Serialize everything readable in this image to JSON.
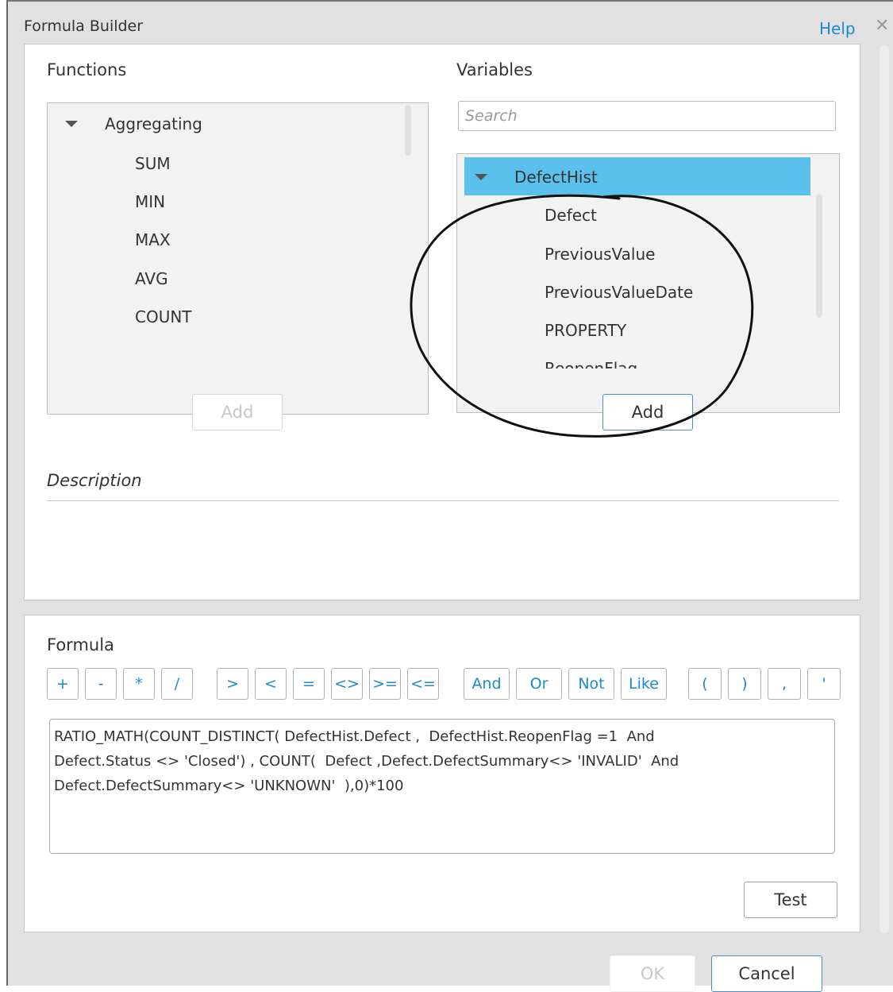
{
  "dialog": {
    "title": "Formula Builder",
    "help_label": "Help",
    "close_glyph": "✕"
  },
  "functions": {
    "label": "Functions",
    "group": "Aggregating",
    "items": [
      "SUM",
      "MIN",
      "MAX",
      "AVG",
      "COUNT"
    ],
    "add_label": "Add"
  },
  "variables": {
    "label": "Variables",
    "search_placeholder": "Search",
    "group": "DefectHist",
    "items": [
      "Defect",
      "PreviousValue",
      "PreviousValueDate",
      "PROPERTY",
      "ReopenFlag"
    ],
    "add_label": "Add"
  },
  "description": {
    "label": "Description"
  },
  "formula": {
    "label": "Formula",
    "operators": [
      "+",
      "-",
      "*",
      "/",
      ">",
      "<",
      "=",
      "<>",
      ">=",
      "<=",
      "And",
      "Or",
      "Not",
      "Like",
      "(",
      ")",
      ",",
      "'"
    ],
    "text": "RATIO_MATH(COUNT_DISTINCT( DefectHist.Defect ,  DefectHist.ReopenFlag =1  And\nDefect.Status <> 'Closed') , COUNT(  Defect ,Defect.DefectSummary<> 'INVALID'  And\nDefect.DefectSummary<> 'UNKNOWN'  ),0)*100",
    "test_label": "Test"
  },
  "footer": {
    "ok_label": "OK",
    "cancel_label": "Cancel"
  },
  "colors": {
    "accent": "#1a8ad0",
    "selection": "#5bc0ec",
    "dialog_bg": "#e1e1e1"
  }
}
